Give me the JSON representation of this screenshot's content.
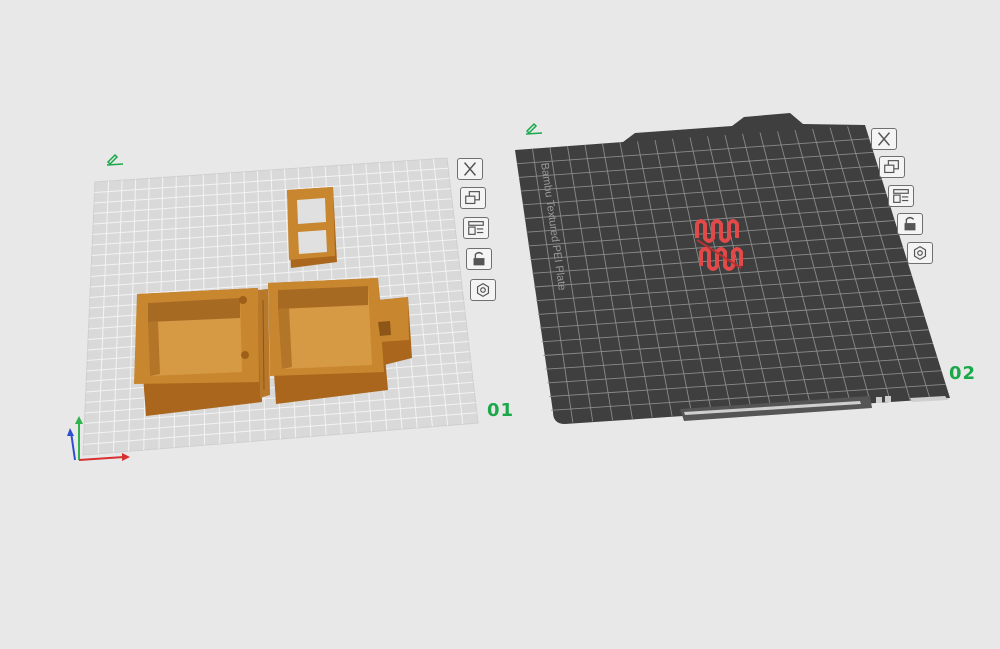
{
  "plates": [
    {
      "id": "plate-01",
      "label": "01"
    },
    {
      "id": "plate-02",
      "label": "02",
      "bed_text": "Bambu Textured PEI Plate"
    }
  ],
  "toolbar_icons": [
    "close-icon",
    "arrange-icon",
    "layout-icon",
    "lock-icon",
    "settings-icon"
  ],
  "colors": {
    "background": "#e8e8e8",
    "plate_light": "#d9d9d9",
    "plate_dark": "#3f3f3f",
    "model_orange": "#c8862e",
    "model_red": "#e24a4a",
    "label_green": "#1aa84a"
  }
}
